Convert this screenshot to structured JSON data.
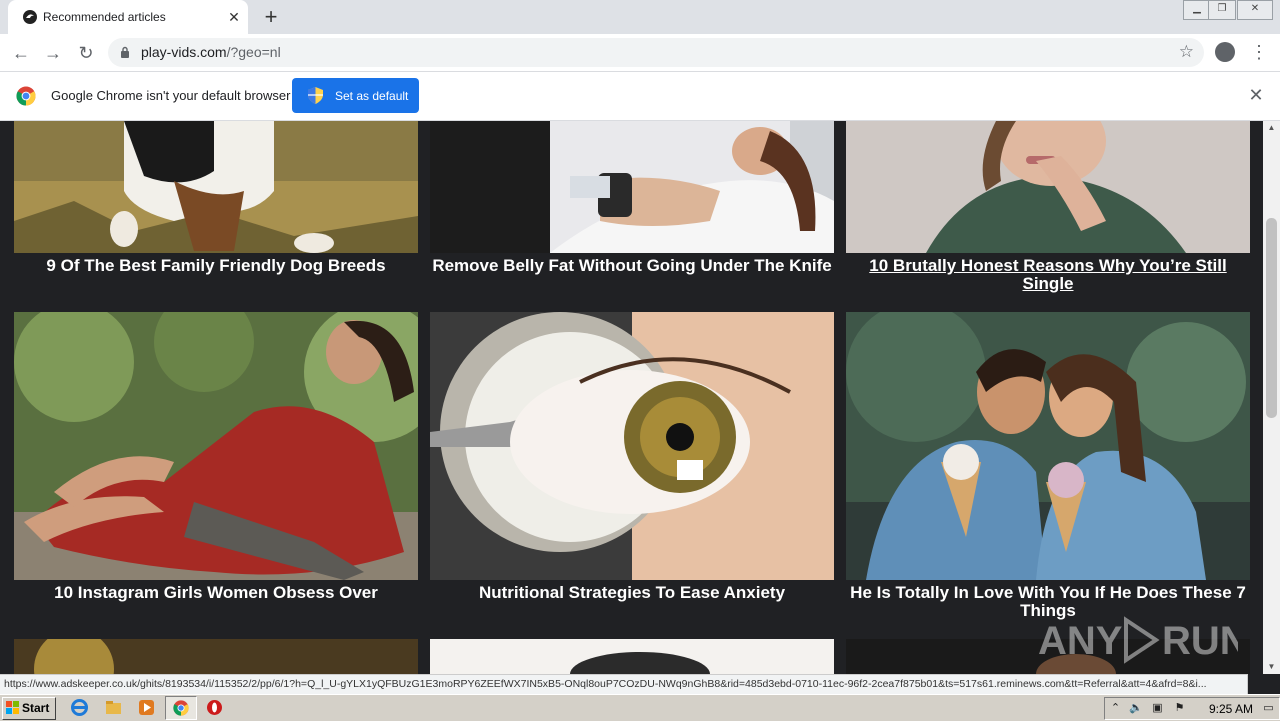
{
  "browser": {
    "tab_title": "Recommended articles",
    "url_host": "play-vids.com",
    "url_rest": "/?geo=nl"
  },
  "infobar": {
    "message": "Google Chrome isn't your default browser",
    "button_label": "Set as default"
  },
  "articles": [
    {
      "title": "9 Of The Best Family Friendly Dog Breeds"
    },
    {
      "title": "Remove Belly Fat Without Going Under The Knife"
    },
    {
      "title": "10 Brutally Honest Reasons Why You’re Still Single"
    },
    {
      "title": "10 Instagram Girls Women Obsess Over"
    },
    {
      "title": "Nutritional Strategies To Ease Anxiety"
    },
    {
      "title": "He Is Totally In Love With You If He Does These 7 Things"
    }
  ],
  "status_url": "https://www.adskeeper.co.uk/ghits/8193534/i/115352/2/pp/6/1?h=Q_l_U-gYLX1yQFBUzG1E3moRPY6ZEEfWX7IN5xB5-ONql8ouP7COzDU-NWq9nGhB8&rid=485d3ebd-0710-11ec-96f2-2cea7f875b01&ts=517s61.reminews.com&tt=Referral&att=4&afrd=8&i...",
  "watermark": "ANY RUN",
  "taskbar": {
    "start_label": "Start",
    "clock": "9:25 AM"
  },
  "colors": {
    "page_bg": "#202124",
    "accent": "#1a73e8"
  }
}
